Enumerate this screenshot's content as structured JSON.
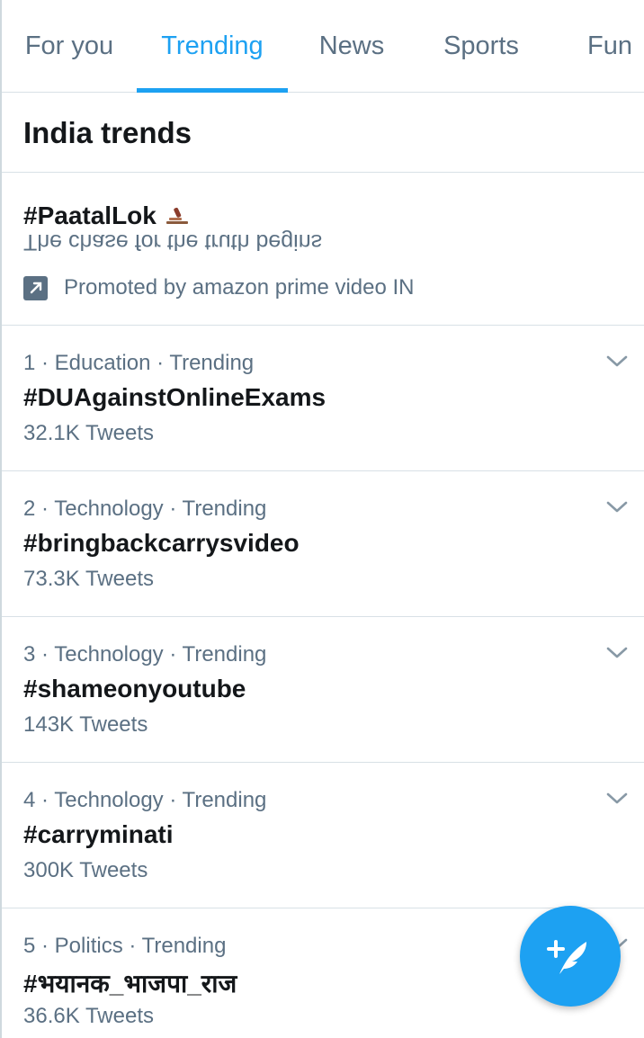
{
  "tabs": [
    {
      "label": "For you",
      "active": false
    },
    {
      "label": "Trending",
      "active": true
    },
    {
      "label": "News",
      "active": false
    },
    {
      "label": "Sports",
      "active": false
    },
    {
      "label": "Fun",
      "active": false
    }
  ],
  "section": {
    "title": "India trends"
  },
  "promoted": {
    "hashtag": "#PaatalLok",
    "description": "The chase for the truth begins",
    "label": "Promoted by amazon prime video IN",
    "icon": "promoted-arrow-icon"
  },
  "trends": [
    {
      "meta": "1 · Education · Trending",
      "hashtag": "#DUAgainstOnlineExams",
      "count": "32.1K Tweets"
    },
    {
      "meta": "2 · Technology · Trending",
      "hashtag": "#bringbackcarrysvideo",
      "count": "73.3K Tweets"
    },
    {
      "meta": "3 · Technology · Trending",
      "hashtag": "#shameonyoutube",
      "count": "143K Tweets"
    },
    {
      "meta": "4 · Technology · Trending",
      "hashtag": "#carryminati",
      "count": "300K Tweets"
    },
    {
      "meta": "5 · Politics · Trending",
      "hashtag": "#भयानक_भाजपा_राज",
      "count": "36.6K Tweets"
    }
  ],
  "fab": {
    "icon": "compose-tweet-icon"
  },
  "colors": {
    "accent": "#1da1f2",
    "text_primary": "#14171a",
    "text_secondary": "#5b7083",
    "divider": "#d8e1e6"
  }
}
